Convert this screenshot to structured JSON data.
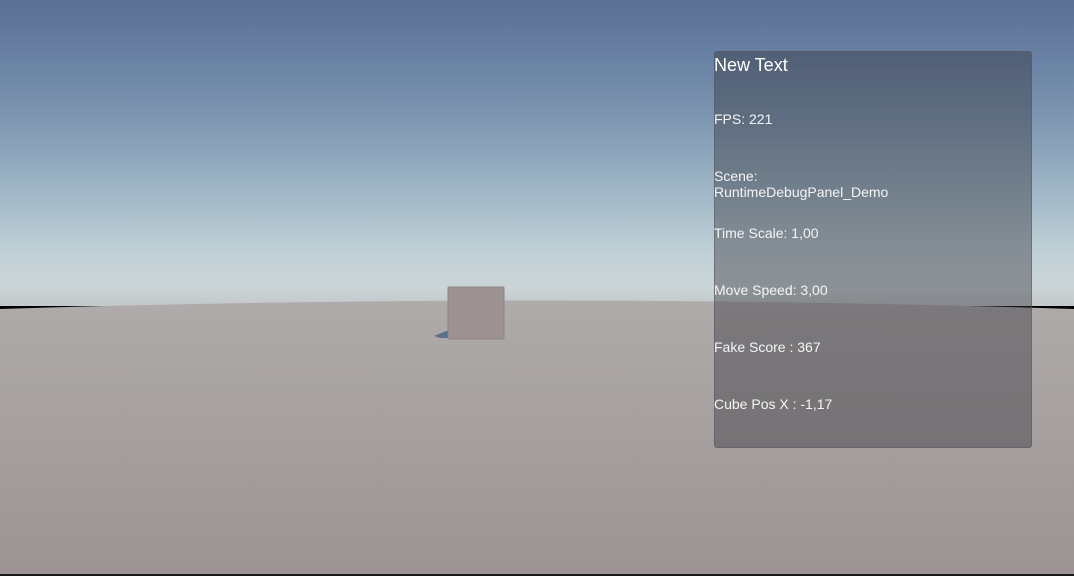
{
  "debug_panel": {
    "title": "New Text",
    "fps": "FPS: 221",
    "scene_label": "Scene:",
    "scene_name": "RuntimeDebugPanel_Demo",
    "time_scale": "Time Scale: 1,00",
    "move_speed": "Move Speed: 3,00",
    "fake_score": "Fake Score  : 367",
    "cube_pos_x": "Cube Pos X  : -1,17"
  },
  "colors": {
    "sky_top": "#5a7195",
    "horizon": "#cbd5d7",
    "ground": "#a39c9c",
    "cube_face": "#9b9291",
    "panel_bg": "rgba(52,52,60,0.42)"
  }
}
